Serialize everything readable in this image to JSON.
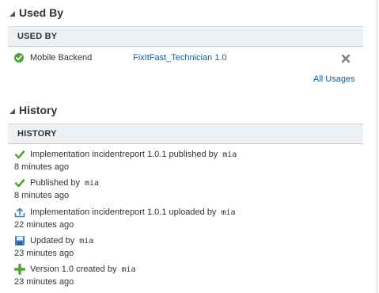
{
  "used_by": {
    "section_title": "Used By",
    "table_header": "USED BY",
    "rows": [
      {
        "type": "Mobile Backend",
        "name": "FixItFast_Technician 1.0"
      }
    ],
    "all_usages_link": "All Usages"
  },
  "history": {
    "section_title": "History",
    "table_header": "HISTORY",
    "items": [
      {
        "icon": "checkmark-icon",
        "text": "Implementation incidentreport 1.0.1 published by",
        "user": "mia",
        "time": "8 minutes ago"
      },
      {
        "icon": "checkmark-icon",
        "text": "Published by",
        "user": "mia",
        "time": "8 minutes ago"
      },
      {
        "icon": "upload-icon",
        "text": "Implementation incidentreport 1.0.1 uploaded by",
        "user": "mia",
        "time": "22 minutes ago"
      },
      {
        "icon": "save-disk-icon",
        "text": "Updated by",
        "user": "mia",
        "time": "23 minutes ago"
      },
      {
        "icon": "plus-icon",
        "text": "Version 1.0 created by",
        "user": "mia",
        "time": "23 minutes ago"
      }
    ]
  },
  "colors": {
    "link": "#145c9e",
    "header_bg": "#edf1f6",
    "check_green": "#51a336"
  }
}
